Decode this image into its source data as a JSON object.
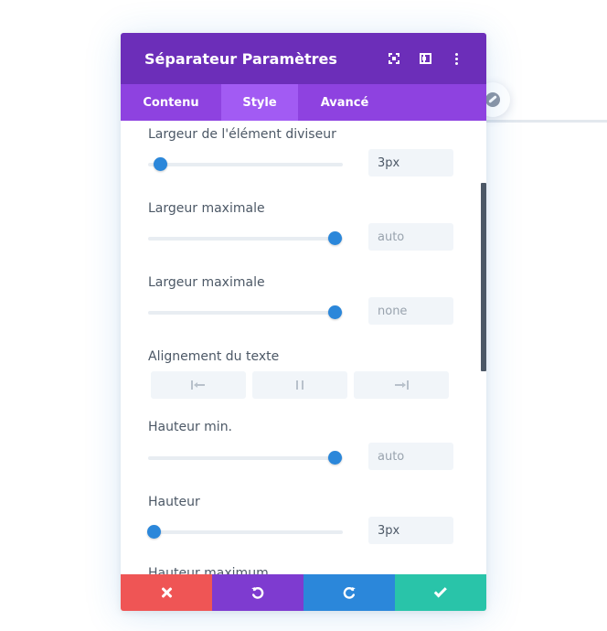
{
  "modal": {
    "title": "Séparateur Paramètres"
  },
  "tabs": [
    {
      "label": "Contenu",
      "active": false
    },
    {
      "label": "Style",
      "active": true
    },
    {
      "label": "Avancé",
      "active": false
    }
  ],
  "fields": {
    "divider_width": {
      "label": "Largeur de l'élément diviseur",
      "value": "3px",
      "slider": 0.06
    },
    "max_width_1": {
      "label": "Largeur maximale",
      "placeholder": "auto",
      "slider": 0.96
    },
    "max_width_2": {
      "label": "Largeur maximale",
      "placeholder": "none",
      "slider": 0.96
    },
    "text_align": {
      "label": "Alignement du texte",
      "options": [
        "left-align-icon",
        "center-align-icon",
        "right-align-icon"
      ]
    },
    "min_height": {
      "label": "Hauteur min.",
      "placeholder": "auto",
      "slider": 0.96
    },
    "height": {
      "label": "Hauteur",
      "value": "3px",
      "slider": 0.03
    },
    "max_height": {
      "label": "Hauteur maximum"
    }
  },
  "footer": {
    "buttons": [
      "cancel",
      "undo",
      "redo",
      "save"
    ]
  },
  "colors": {
    "header": "#6c2eb9",
    "tabs": "#8e42e0",
    "active_tab": "#a25bf3",
    "accent": "#2b87da",
    "cancel": "#ef5555",
    "undo": "#7e3bd0",
    "redo": "#2b87da",
    "save": "#29c4a9"
  }
}
